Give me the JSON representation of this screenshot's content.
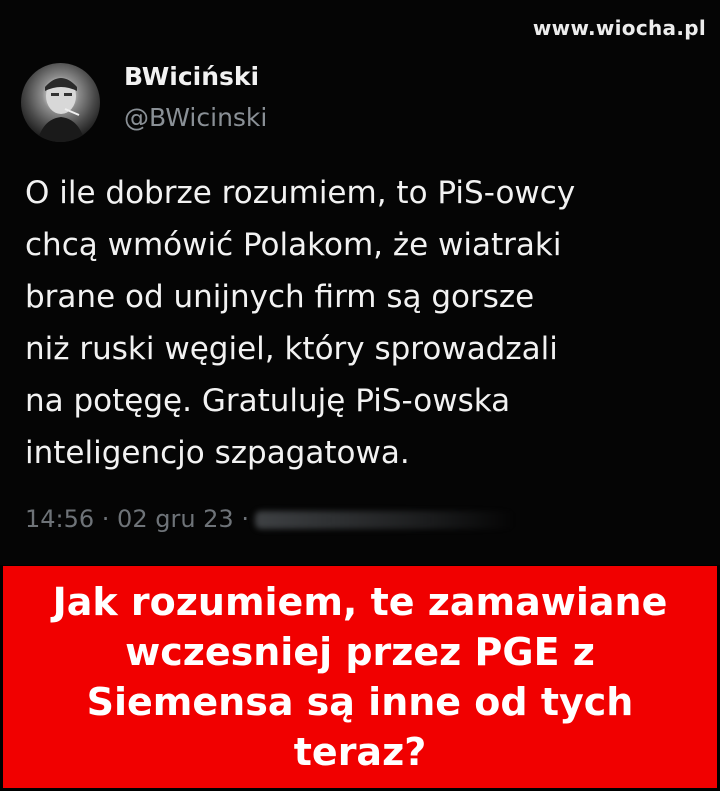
{
  "watermark": "www.wiocha.pl",
  "tweet": {
    "display_name": "BWiciński",
    "handle": "@BWicinski",
    "text": "O ile dobrze rozumiem, to PiS-owcy\nchcą wmówić Polakom, że wiatraki\nbrane od unijnych firm są gorsze\nniż ruski węgiel, który sprowadzali\nna potęgę. Gratuluję PiS-owska\ninteligencjo szpagatowa.",
    "timestamp": "14:56 · 02 gru 23 ·"
  },
  "banner": {
    "text": "Jak rozumiem, te zamawiane\nwczesniej przez PGE z\nSiemensa są inne od tych\nteraz?",
    "background": "#f10000",
    "text_color": "#ffffff"
  }
}
